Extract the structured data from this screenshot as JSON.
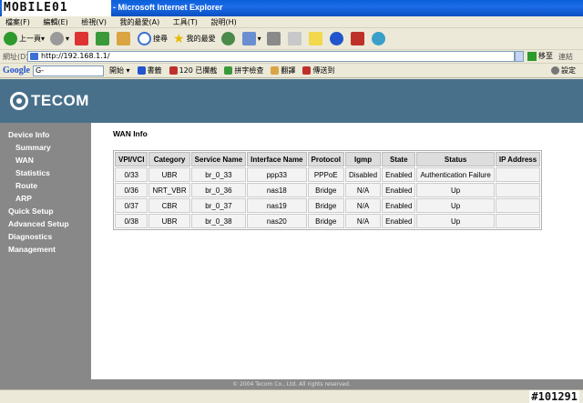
{
  "window": {
    "logo_text": "MOBILE01",
    "title": "- Microsoft Internet Explorer"
  },
  "menu": [
    "檔案(F)",
    "編輯(E)",
    "檢視(V)",
    "我的最愛(A)",
    "工具(T)",
    "說明(H)"
  ],
  "toolbar": {
    "back_label": "上一頁",
    "search_label": "搜尋",
    "favorites_label": "我的最愛"
  },
  "address": {
    "label": "網址(D)",
    "url": "http://192.168.1.1/",
    "go_label": "移至",
    "links_label": "連結"
  },
  "google_bar": {
    "brand": "Google",
    "input_value": "G-",
    "start_label": "開始",
    "bookmarks_label": "書籤",
    "blocked_label": "120 已攔截",
    "spell_label": "拼字檢查",
    "translate_label": "翻譯",
    "send_label": "傳送到",
    "settings_label": "設定"
  },
  "banner": {
    "brand": "TECOM"
  },
  "sidebar": [
    {
      "label": "Device Info",
      "level": 0
    },
    {
      "label": "Summary",
      "level": 1
    },
    {
      "label": "WAN",
      "level": 1
    },
    {
      "label": "Statistics",
      "level": 1
    },
    {
      "label": "Route",
      "level": 1
    },
    {
      "label": "ARP",
      "level": 1
    },
    {
      "label": "Quick Setup",
      "level": 0
    },
    {
      "label": "Advanced Setup",
      "level": 0
    },
    {
      "label": "Diagnostics",
      "level": 0
    },
    {
      "label": "Management",
      "level": 0
    }
  ],
  "content": {
    "heading": "WAN Info",
    "columns": [
      "VPI/VCI",
      "Category",
      "Service Name",
      "Interface Name",
      "Protocol",
      "Igmp",
      "State",
      "Status",
      "IP Address"
    ],
    "rows": [
      [
        "0/33",
        "UBR",
        "br_0_33",
        "ppp33",
        "PPPoE",
        "Disabled",
        "Enabled",
        "Authentication Failure",
        ""
      ],
      [
        "0/36",
        "NRT_VBR",
        "br_0_36",
        "nas18",
        "Bridge",
        "N/A",
        "Enabled",
        "Up",
        ""
      ],
      [
        "0/37",
        "CBR",
        "br_0_37",
        "nas19",
        "Bridge",
        "N/A",
        "Enabled",
        "Up",
        ""
      ],
      [
        "0/38",
        "UBR",
        "br_0_38",
        "nas20",
        "Bridge",
        "N/A",
        "Enabled",
        "Up",
        ""
      ]
    ]
  },
  "footer": "© 2004 Tecom Co., Ltd. All rights reserved.",
  "status": {
    "watermark": "#101291"
  }
}
